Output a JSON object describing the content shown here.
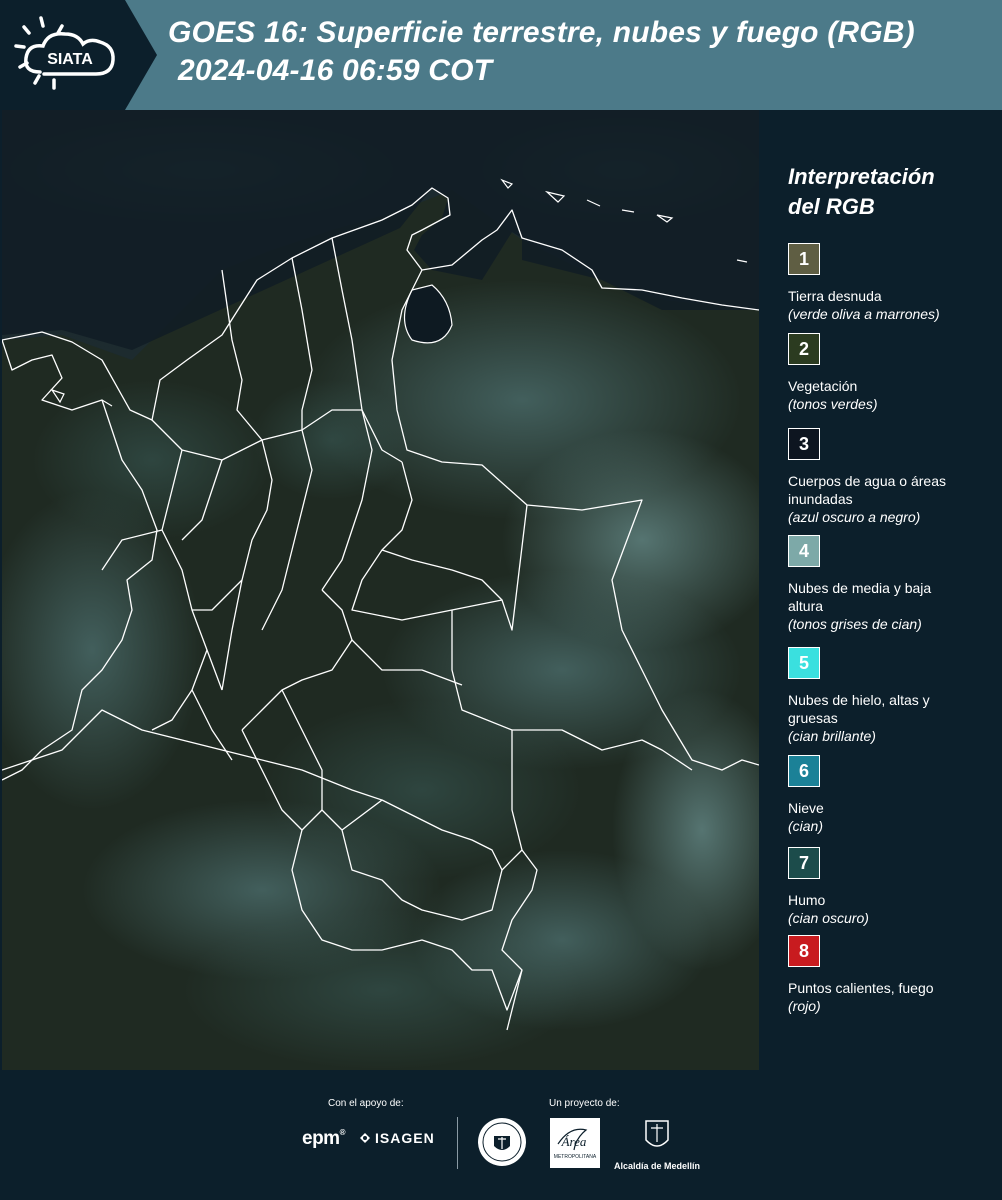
{
  "header": {
    "logo_text": "SIATA",
    "title_line1": "GOES 16: Superficie terrestre, nubes y fuego (RGB)",
    "title_line2": "2024-04-16 06:59 COT",
    "colors": {
      "band": "#4c7a89",
      "background": "#0c1f2b"
    }
  },
  "map": {
    "description_icon": "satellite-map",
    "boundary_color": "#ffffff"
  },
  "legend": {
    "title_line1": "Interpretación",
    "title_line2": "del RGB",
    "items": [
      {
        "number": "1",
        "label": "Tierra desnuda",
        "sub": "(verde oliva a marrones)",
        "color": "#5f5e43"
      },
      {
        "number": "2",
        "label": "Vegetación",
        "sub": "(tonos verdes)",
        "color": "#2b3b20"
      },
      {
        "number": "3",
        "label": "Cuerpos de agua o áreas inundadas",
        "sub": "(azul oscuro a negro)",
        "color": "#0d1520"
      },
      {
        "number": "4",
        "label": "Nubes de media y baja altura",
        "sub": "(tonos grises de cian)",
        "color": "#7da9a8"
      },
      {
        "number": "5",
        "label": "Nubes de hielo, altas y gruesas",
        "sub": "(cian brillante)",
        "color": "#3ae0df"
      },
      {
        "number": "6",
        "label": "Nieve",
        "sub": "(cian)",
        "color": "#1b8197"
      },
      {
        "number": "7",
        "label": "Humo",
        "sub": "(cian oscuro)",
        "color": "#1c4c4b"
      },
      {
        "number": "8",
        "label": "Puntos calientes, fuego",
        "sub": "(rojo)",
        "color": "#c81b1f"
      }
    ]
  },
  "footer": {
    "support_label": "Con el apoyo de:",
    "project_label": "Un proyecto de:",
    "epm": "epm",
    "isagen": "ISAGEN",
    "area_logo_text": "Área",
    "area_logo_sub": "METROPOLITANA",
    "alcaldia": "Alcaldía de Medellín"
  }
}
